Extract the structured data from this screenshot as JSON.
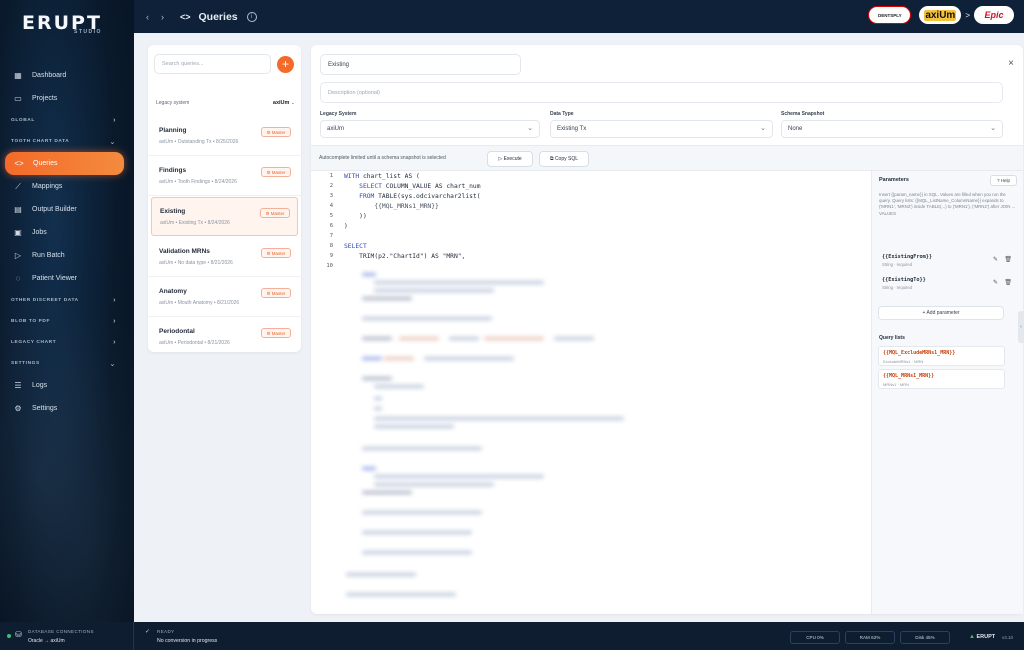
{
  "app": {
    "logo_main": "ERUPT",
    "logo_sub": "STUDIO"
  },
  "sidebar": {
    "dashboard": "Dashboard",
    "projects": "Projects",
    "sections": {
      "global": "GLOBAL",
      "tooth_chart_data": "TOOTH CHART DATA",
      "other_discreet_data": "OTHER DISCREET DATA",
      "blob_to_pdf": "BLOB TO PDF",
      "legacy_chart": "LEGACY CHART",
      "settings": "SETTINGS"
    },
    "queries": "Queries",
    "mappings": "Mappings",
    "output_builder": "Output Builder",
    "jobs": "Jobs",
    "run_batch": "Run Batch",
    "patient_viewer": "Patient Viewer",
    "logs": "Logs",
    "settings_item": "Settings"
  },
  "topbar": {
    "back": "‹",
    "forward": "›",
    "title_icon": "<>",
    "title": "Queries",
    "info": "i",
    "brands": {
      "dentsply": "DENTSPLY",
      "axium": "axiUm",
      "separator": ">",
      "epic": "Epic"
    }
  },
  "query_list": {
    "search_placeholder": "Search queries...",
    "add": "+",
    "legacy_label": "Legacy system",
    "legacy_value": "axiUm",
    "legacy_chevron": "⌄",
    "items": [
      {
        "name": "Planning",
        "meta": "axiUm  •  Outstanding Tx  •  8/25/2026",
        "badge": "Master"
      },
      {
        "name": "Findings",
        "meta": "axiUm  •  Tooth Findings  •  8/24/2026",
        "badge": "Master"
      },
      {
        "name": "Existing",
        "meta": "axiUm  •  Existing Tx  •  8/24/2026",
        "badge": "Master"
      },
      {
        "name": "Validation MRNs",
        "meta": "axiUm  •  No data type  •  8/21/2026",
        "badge": "Master"
      },
      {
        "name": "Anatomy",
        "meta": "axiUm  •  Mouth Anatomy  •  8/21/2026",
        "badge": "Master"
      },
      {
        "name": "Periodontal",
        "meta": "axiUm  •  Periodontal  •  8/21/2026",
        "badge": "Master"
      }
    ]
  },
  "editor": {
    "name_value": "Existing",
    "close": "×",
    "description_placeholder": "Description (optional)",
    "legacy_system_label": "Legacy System",
    "legacy_system_value": "axiUm",
    "data_type_label": "Data Type",
    "data_type_value": "Existing Tx",
    "schema_label": "Schema Snapshot",
    "schema_value": "None",
    "dropdown": "⌄",
    "autocomplete_note": "Autocomplete limited until a schema snapshot is selected",
    "execute_label": "▷ Execute",
    "copy_label": "⧉ Copy SQL",
    "line_numbers": [
      "1",
      "2",
      "3",
      "4",
      "5",
      "6",
      "7",
      "8",
      "9",
      "10"
    ],
    "code_lines": [
      [
        "WITH ",
        "chart_list AS (",
        ""
      ],
      [
        "    SELECT ",
        "COLUMN_VALUE ",
        "AS chart_num"
      ],
      [
        "    FROM ",
        "TABLE(sys.odcivarchar2list(",
        ""
      ],
      [
        "        ",
        "{{MQL_MRNs1_MRN}}",
        ""
      ],
      [
        "    ",
        "))",
        ""
      ],
      [
        "",
        ")",
        ""
      ],
      [
        "",
        "",
        ""
      ],
      [
        "SELECT",
        "",
        ""
      ],
      [
        "    ",
        "TRIM(p2.\"ChartId\") AS \"MRN\",",
        ""
      ],
      [
        "",
        "",
        ""
      ]
    ]
  },
  "params": {
    "title": "Parameters",
    "help": "? Help",
    "desc": "Insert {{param_name}} in SQL. Values are filled when you run the query. Query lists: {{MQL_ListName_ColumnName}} expands to ('MRN1', 'MRN2') inside TABLE(...) to ('MRN1'), ('MRN2') after JOIN ... VALUES",
    "items": [
      {
        "name": "{{ExistingFrom}}",
        "sub": "String · required"
      },
      {
        "name": "{{ExistingTo}}",
        "sub": "String · required"
      }
    ],
    "edit_icon": "✎",
    "delete_icon": "🗑",
    "add_label": "+ Add parameter",
    "query_lists_title": "Query lists",
    "query_lists": [
      {
        "name": "{{MQL_ExcludeMRNs1_MRN}}",
        "sub": "ExcludeMRNs1 · MRN"
      },
      {
        "name": "{{MQL_MRNs1_MRN}}",
        "sub": "MRNs1 · MRN"
      }
    ],
    "collapse": "‹"
  },
  "status": {
    "db_label": "DATABASE CONNECTIONS",
    "db_value": "Oracle → axiUm",
    "ready_icon": "✓",
    "ready_label": "READY",
    "ready_text": "No conversion in progress",
    "cpu": "CPU 0%",
    "ram": "RAM 62%",
    "disk": "Disk 45%",
    "brand": "ERUPT",
    "brand_icon": "▲",
    "version": "v3.10"
  },
  "colors": {
    "accent": "#f46a2a",
    "sidebar_bg": "#0a1a2c",
    "status_ok": "#38c172"
  }
}
